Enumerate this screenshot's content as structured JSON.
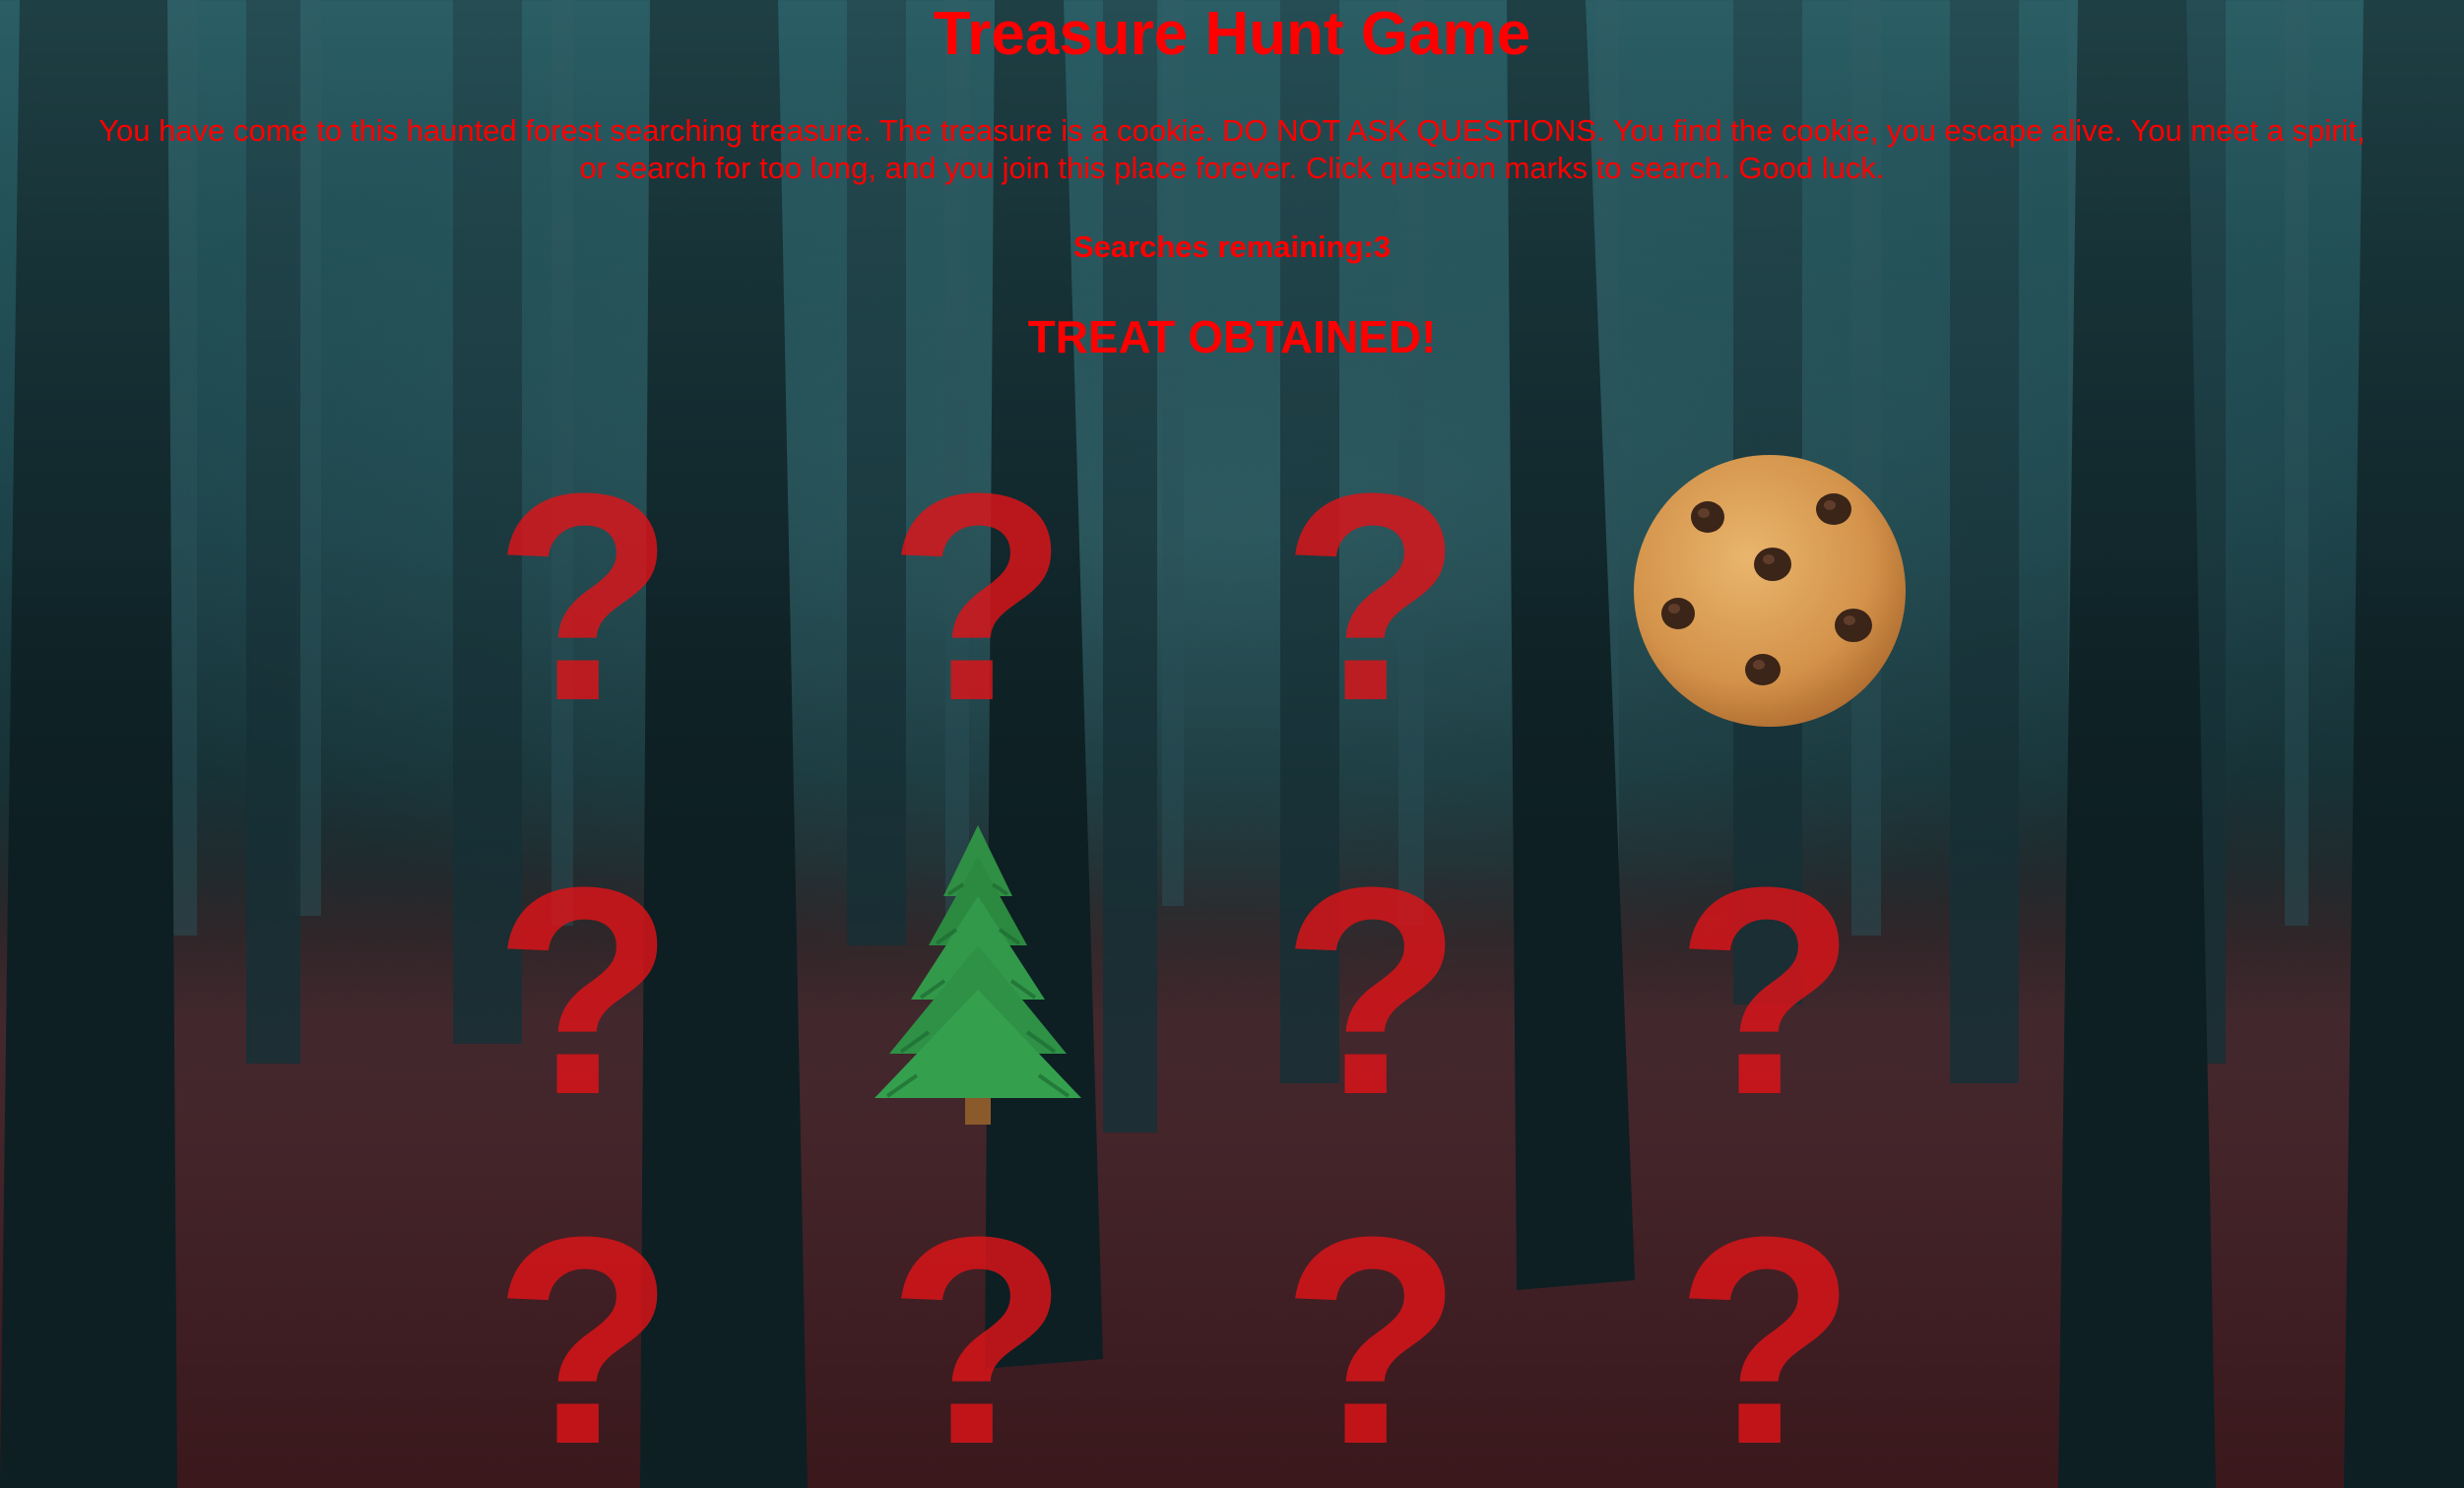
{
  "game": {
    "title": "Treasure Hunt Game",
    "intro": "You have come to this haunted forest searching treasure. The treasure is a cookie. DO NOT ASK QUESTIONS. You find the cookie, you escape alive. You meet a spirit, or search for too long, and you join this place forever. Click question marks to search. Good luck.",
    "searches_label": "Searches remaining:",
    "searches_remaining": "3",
    "status": "TREAT OBTAINED!",
    "text_color": "#ff0000",
    "hidden_symbol": "?",
    "grid": [
      {
        "row": 1,
        "col": 1,
        "state": "hidden"
      },
      {
        "row": 1,
        "col": 2,
        "state": "hidden"
      },
      {
        "row": 1,
        "col": 3,
        "state": "hidden"
      },
      {
        "row": 1,
        "col": 4,
        "state": "revealed",
        "item": "cookie-icon"
      },
      {
        "row": 2,
        "col": 1,
        "state": "hidden"
      },
      {
        "row": 2,
        "col": 2,
        "state": "revealed",
        "item": "evergreen-tree-icon"
      },
      {
        "row": 2,
        "col": 3,
        "state": "hidden"
      },
      {
        "row": 2,
        "col": 4,
        "state": "hidden"
      },
      {
        "row": 3,
        "col": 1,
        "state": "hidden"
      },
      {
        "row": 3,
        "col": 2,
        "state": "hidden"
      },
      {
        "row": 3,
        "col": 3,
        "state": "hidden"
      },
      {
        "row": 3,
        "col": 4,
        "state": "hidden"
      }
    ]
  }
}
